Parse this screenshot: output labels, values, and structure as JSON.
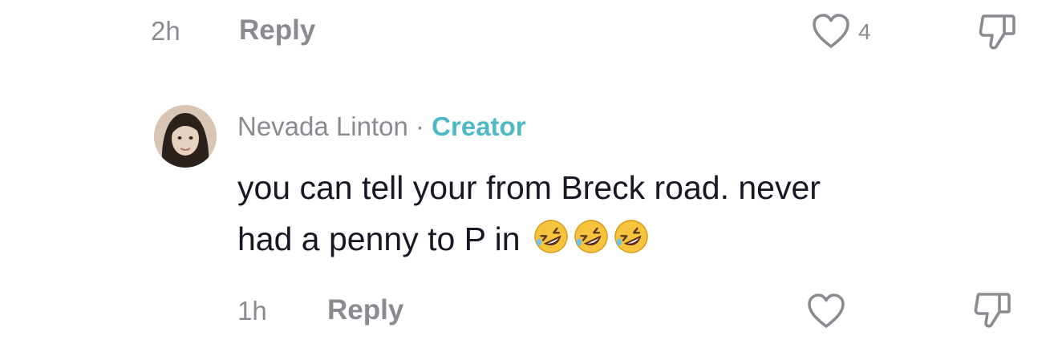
{
  "previous_comment": {
    "time": "2h",
    "reply_label": "Reply",
    "like_count": "4",
    "icons": {
      "like": "heart-outline-icon",
      "dislike": "thumbs-down-icon"
    }
  },
  "comment": {
    "author": "Nevada Linton",
    "separator": "·",
    "author_badge": "Creator",
    "text_line1": "you can tell your from Breck road. never",
    "text_line2": "had a penny to P in",
    "emoji": [
      "rolling-on-floor-laughing",
      "rolling-on-floor-laughing",
      "rolling-on-floor-laughing"
    ],
    "time": "1h",
    "reply_label": "Reply",
    "icons": {
      "like": "heart-outline-icon",
      "dislike": "thumbs-down-icon"
    }
  },
  "colors": {
    "muted": "#8a8b91",
    "creator_badge": "#4fb8c6",
    "text": "#161823"
  }
}
